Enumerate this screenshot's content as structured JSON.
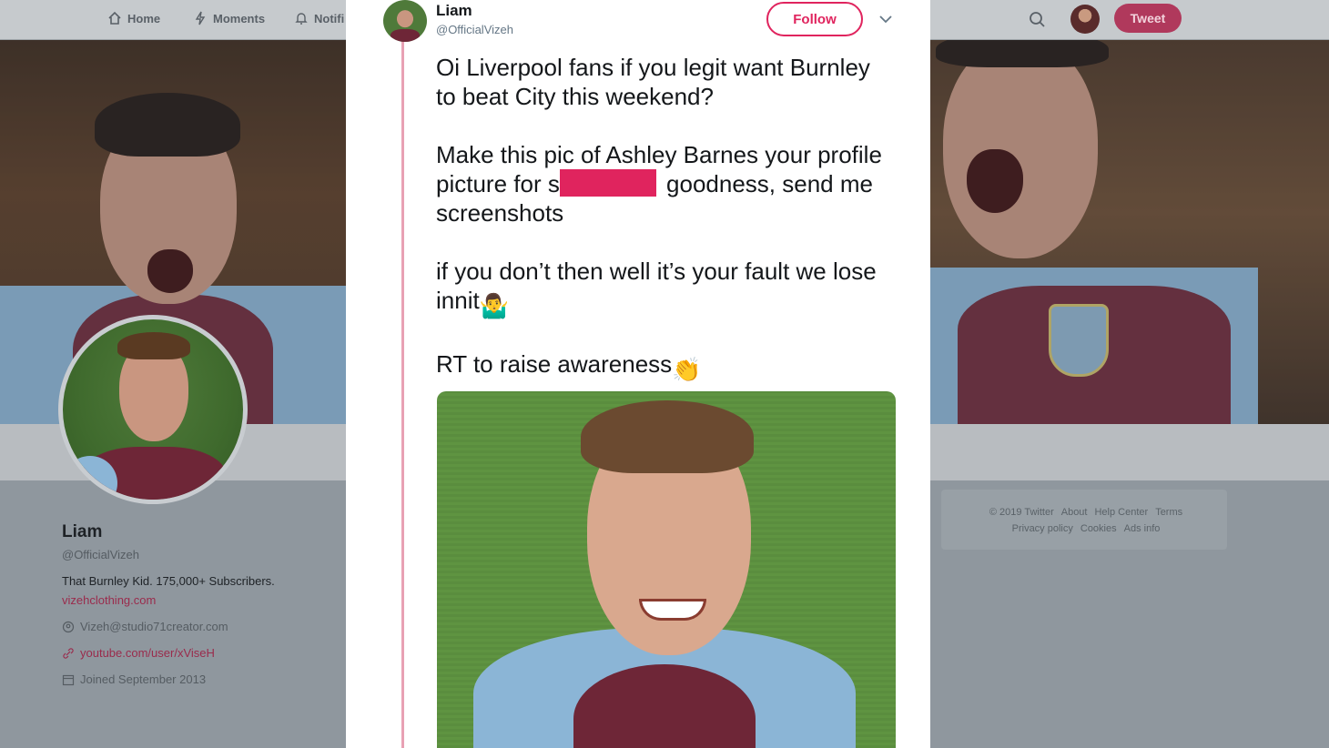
{
  "nav": {
    "home": "Home",
    "moments": "Moments",
    "notifications": "Notifi",
    "tweet_button": "Tweet"
  },
  "profile": {
    "name": "Liam",
    "handle": "@OfficialVizeh",
    "bio": "That Burnley Kid. 175,000+ Subscribers.",
    "bio_link": "vizehclothing.com",
    "location": "Vizeh@studio71creator.com",
    "website": "youtube.com/user/xViseH",
    "joined": "Joined September 2013"
  },
  "footer": {
    "links": [
      "© 2019 Twitter",
      "About",
      "Help Center",
      "Terms",
      "Privacy policy",
      "Cookies",
      "Ads info"
    ]
  },
  "tweet": {
    "author_name": "Liam",
    "author_handle": "@OfficialVizeh",
    "follow_label": "Follow",
    "line1": "Oi Liverpool fans if you legit want Burnley to beat City this weekend?",
    "line2_a": "Make this pic of Ashley Barnes your profile picture for s",
    "line2_b": " goodness, send me screenshots",
    "line3": "if you don’t then well it’s your fault we lose innit",
    "line3_emoji": "🤷‍♂️",
    "line4": "RT to raise awareness",
    "line4_emoji": "👏"
  },
  "colors": {
    "accent": "#e0245e",
    "redaction": "#e0245e",
    "thread_line": "#e8a1b4"
  }
}
